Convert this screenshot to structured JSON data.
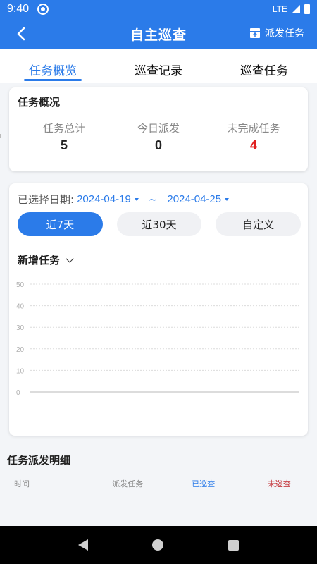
{
  "status_bar": {
    "time": "9:40",
    "network": "LTE"
  },
  "app_bar": {
    "title": "自主巡查",
    "dispatch_label": "派发任务"
  },
  "tabs": [
    {
      "label": "任务概览",
      "active": true
    },
    {
      "label": "巡查记录",
      "active": false
    },
    {
      "label": "巡查任务",
      "active": false
    }
  ],
  "overview": {
    "title": "任务概况",
    "stats": [
      {
        "label": "任务总计",
        "value": "5"
      },
      {
        "label": "今日派发",
        "value": "0"
      },
      {
        "label": "未完成任务",
        "value": "4"
      }
    ]
  },
  "filter": {
    "label": "已选择日期:",
    "start_date": "2024-04-19",
    "separator": "~",
    "end_date": "2024-04-25",
    "ranges": [
      {
        "label": "近7天",
        "active": true
      },
      {
        "label": "近30天",
        "active": false
      },
      {
        "label": "自定义",
        "active": false
      }
    ]
  },
  "chart_data": {
    "type": "line",
    "title": "新增任务",
    "y_ticks": [
      "50",
      "40",
      "30",
      "20",
      "10",
      "0"
    ],
    "ylim": [
      0,
      50
    ],
    "series": [],
    "grid": true
  },
  "detail": {
    "title": "任务派发明细",
    "columns": [
      "时间",
      "派发任务",
      "已巡查",
      "未巡查"
    ]
  },
  "colors": {
    "primary": "#2b7be9",
    "danger": "#e02020",
    "undone": "#c0262c"
  }
}
